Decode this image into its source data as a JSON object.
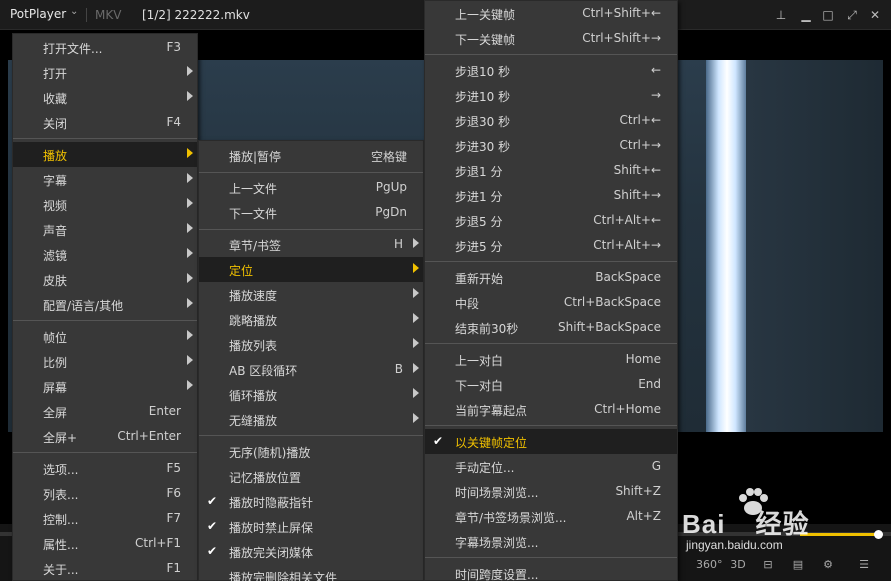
{
  "titlebar": {
    "app_name": "PotPlayer",
    "container_format": "MKV",
    "file_title": "[1/2] 222222.mkv"
  },
  "menu_main": {
    "items": [
      {
        "label": "打开文件...",
        "shortcut": "F3"
      },
      {
        "label": "打开",
        "shortcut": ""
      },
      {
        "label": "收藏",
        "shortcut": ""
      },
      {
        "label": "关闭",
        "shortcut": "F4"
      },
      {
        "label": "播放",
        "shortcut": ""
      },
      {
        "label": "字幕",
        "shortcut": ""
      },
      {
        "label": "视频",
        "shortcut": ""
      },
      {
        "label": "声音",
        "shortcut": ""
      },
      {
        "label": "滤镜",
        "shortcut": ""
      },
      {
        "label": "皮肤",
        "shortcut": ""
      },
      {
        "label": "配置/语言/其他",
        "shortcut": ""
      },
      {
        "label": "帧位",
        "shortcut": ""
      },
      {
        "label": "比例",
        "shortcut": ""
      },
      {
        "label": "屏幕",
        "shortcut": ""
      },
      {
        "label": "全屏",
        "shortcut": "Enter"
      },
      {
        "label": "全屏+",
        "shortcut": "Ctrl+Enter"
      },
      {
        "label": "选项...",
        "shortcut": "F5"
      },
      {
        "label": "列表...",
        "shortcut": "F6"
      },
      {
        "label": "控制...",
        "shortcut": "F7"
      },
      {
        "label": "属性...",
        "shortcut": "Ctrl+F1"
      },
      {
        "label": "关于...",
        "shortcut": "F1"
      }
    ]
  },
  "menu_play": {
    "items": [
      {
        "label": "播放|暂停",
        "shortcut": "空格键"
      },
      {
        "label": "上一文件",
        "shortcut": "PgUp"
      },
      {
        "label": "下一文件",
        "shortcut": "PgDn"
      },
      {
        "label": "章节/书签",
        "shortcut": "H"
      },
      {
        "label": "定位",
        "shortcut": ""
      },
      {
        "label": "播放速度",
        "shortcut": ""
      },
      {
        "label": "跳略播放",
        "shortcut": ""
      },
      {
        "label": "播放列表",
        "shortcut": ""
      },
      {
        "label": "AB 区段循环",
        "shortcut": "B"
      },
      {
        "label": "循环播放",
        "shortcut": ""
      },
      {
        "label": "无缝播放",
        "shortcut": ""
      },
      {
        "label": "无序(随机)播放",
        "shortcut": ""
      },
      {
        "label": "记忆播放位置",
        "shortcut": ""
      },
      {
        "label": "播放时隐蔽指针",
        "shortcut": ""
      },
      {
        "label": "播放时禁止屏保",
        "shortcut": ""
      },
      {
        "label": "播放完关闭媒体",
        "shortcut": ""
      },
      {
        "label": "播放完删除相关文件",
        "shortcut": ""
      }
    ]
  },
  "menu_seek": {
    "items": [
      {
        "label": "上一关键帧",
        "shortcut": "Ctrl+Shift+←"
      },
      {
        "label": "下一关键帧",
        "shortcut": "Ctrl+Shift+→"
      },
      {
        "label": "步退10 秒",
        "shortcut": "←"
      },
      {
        "label": "步进10 秒",
        "shortcut": "→"
      },
      {
        "label": "步退30 秒",
        "shortcut": "Ctrl+←"
      },
      {
        "label": "步进30 秒",
        "shortcut": "Ctrl+→"
      },
      {
        "label": "步退1 分",
        "shortcut": "Shift+←"
      },
      {
        "label": "步进1 分",
        "shortcut": "Shift+→"
      },
      {
        "label": "步退5 分",
        "shortcut": "Ctrl+Alt+←"
      },
      {
        "label": "步进5 分",
        "shortcut": "Ctrl+Alt+→"
      },
      {
        "label": "重新开始",
        "shortcut": "BackSpace"
      },
      {
        "label": "中段",
        "shortcut": "Ctrl+BackSpace"
      },
      {
        "label": "结束前30秒",
        "shortcut": "Shift+BackSpace"
      },
      {
        "label": "上一对白",
        "shortcut": "Home"
      },
      {
        "label": "下一对白",
        "shortcut": "End"
      },
      {
        "label": "当前字幕起点",
        "shortcut": "Ctrl+Home"
      },
      {
        "label": "以关键帧定位",
        "shortcut": ""
      },
      {
        "label": "手动定位...",
        "shortcut": "G"
      },
      {
        "label": "时间场景浏览...",
        "shortcut": "Shift+Z"
      },
      {
        "label": "章节/书签场景浏览...",
        "shortcut": "Alt+Z"
      },
      {
        "label": "字幕场景浏览...",
        "shortcut": ""
      },
      {
        "label": "时间跨度设置...",
        "shortcut": ""
      }
    ]
  },
  "controls": {
    "btn_360": "360°",
    "btn_3d": "3D"
  },
  "watermark": {
    "brand": "Bai",
    "brand_suffix": "经验",
    "url": "jingyan.baidu.com"
  },
  "colors": {
    "accent": "#f0c000",
    "menu_bg": "#383838",
    "menu_highlight": "#1f1f1f"
  }
}
